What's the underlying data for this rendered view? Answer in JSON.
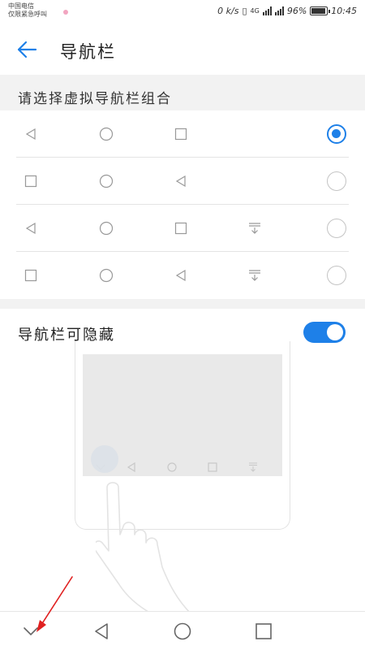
{
  "status_bar": {
    "carrier_line1": "中国电信",
    "carrier_line2": "仅限紧急呼叫",
    "speed": "0 k/s",
    "network": "4G",
    "battery": "96%",
    "time": "10:45"
  },
  "header": {
    "title": "导航栏",
    "back_icon": "back-arrow-icon"
  },
  "combos_section": {
    "label": "请选择虚拟导航栏组合",
    "options": [
      {
        "icons": [
          "back-triangle-icon",
          "home-circle-icon",
          "recents-square-icon"
        ],
        "selected": true
      },
      {
        "icons": [
          "recents-square-icon",
          "home-circle-icon",
          "back-triangle-icon"
        ],
        "selected": false
      },
      {
        "icons": [
          "back-triangle-icon",
          "home-circle-icon",
          "recents-square-icon",
          "notification-pulldown-icon"
        ],
        "selected": false
      },
      {
        "icons": [
          "recents-square-icon",
          "home-circle-icon",
          "back-triangle-icon",
          "notification-pulldown-icon"
        ],
        "selected": false
      }
    ]
  },
  "hide_nav_section": {
    "label": "导航栏可隐藏",
    "enabled": true
  },
  "bottom_nav": {
    "icons": [
      "chevron-down-icon",
      "back-triangle-icon",
      "home-circle-icon",
      "recents-square-icon"
    ]
  },
  "colors": {
    "accent": "#1e80e8",
    "annotation_arrow": "#e02020",
    "background": "#f2f2f2"
  }
}
